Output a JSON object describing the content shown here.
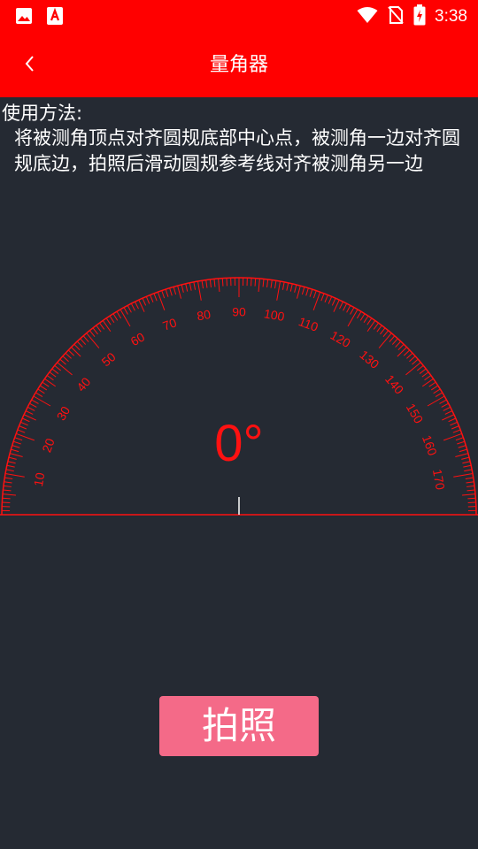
{
  "status_bar": {
    "time": "3:38",
    "icons": [
      "image-icon",
      "font-a-icon",
      "wifi-icon",
      "no-sim-icon",
      "battery-charging-icon"
    ]
  },
  "app_bar": {
    "title": "量角器",
    "back_icon": "chevron-left-icon"
  },
  "instructions": {
    "heading": "使用方法:",
    "body": "将被测角顶点对齐圆规底部中心点，被测角一边对齐圆规底边，拍照后滑动圆规参考线对齐被测角另一边"
  },
  "protractor": {
    "angle_display": "0°",
    "labels": [
      "10",
      "20",
      "30",
      "40",
      "50",
      "60",
      "70",
      "80",
      "90",
      "100",
      "110",
      "120",
      "130",
      "140",
      "150",
      "160",
      "170"
    ],
    "color": "#ff1111"
  },
  "actions": {
    "capture_label": "拍照"
  },
  "colors": {
    "accent": "#ff0000",
    "background": "#252a33",
    "button": "#f46a88"
  }
}
